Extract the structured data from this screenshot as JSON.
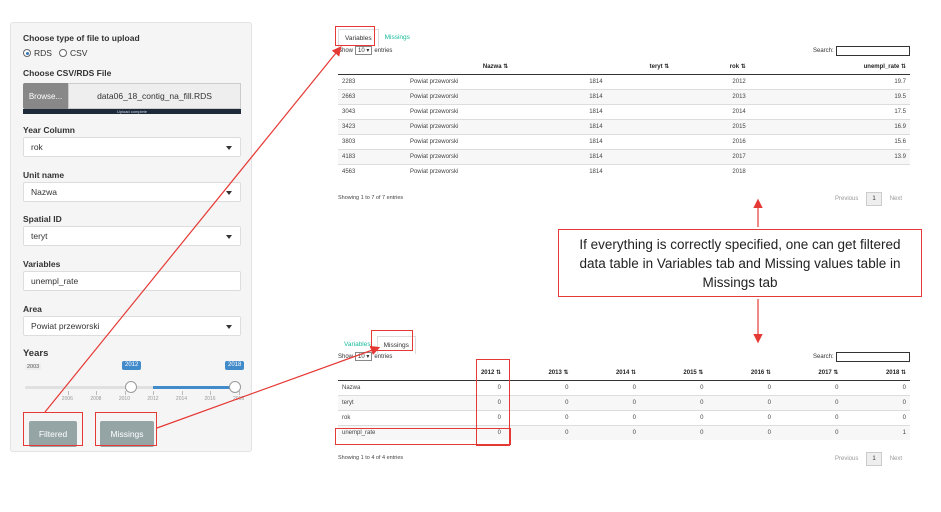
{
  "sidebar": {
    "file_type_label": "Choose type of file to upload",
    "radio_rds": "RDS",
    "radio_csv": "CSV",
    "file_label": "Choose CSV/RDS File",
    "browse_label": "Browse...",
    "file_name": "data06_18_contig_na_fill.RDS",
    "upload_status": "Upload complete",
    "year_col_label": "Year Column",
    "year_col_value": "rok",
    "unit_label": "Unit name",
    "unit_value": "Nazwa",
    "spatial_label": "Spatial ID",
    "spatial_value": "teryt",
    "variables_label": "Variables",
    "variables_value": "unempl_rate",
    "area_label": "Area",
    "area_value": "Powiat przeworski",
    "years_label": "Years",
    "years_min": "2003",
    "years_from": "2012",
    "years_to": "2018",
    "year_ticks": [
      "2006",
      "2008",
      "2010",
      "2012",
      "2014",
      "2016",
      "2018"
    ],
    "filtered_label": "Filtered",
    "missings_label": "Missings"
  },
  "top": {
    "tab_variables": "Variables",
    "tab_missings": "Missings",
    "show_label": "Show",
    "show_value": "10",
    "entries_label": "entries",
    "search_label": "Search:",
    "columns": [
      "",
      "Nazwa",
      "teryt",
      "rok",
      "unempl_rate"
    ],
    "rows": [
      [
        "2283",
        "Powiat przeworski",
        "1814",
        "2012",
        "19.7"
      ],
      [
        "2663",
        "Powiat przeworski",
        "1814",
        "2013",
        "19.5"
      ],
      [
        "3043",
        "Powiat przeworski",
        "1814",
        "2014",
        "17.5"
      ],
      [
        "3423",
        "Powiat przeworski",
        "1814",
        "2015",
        "16.9"
      ],
      [
        "3803",
        "Powiat przeworski",
        "1814",
        "2016",
        "15.6"
      ],
      [
        "4183",
        "Powiat przeworski",
        "1814",
        "2017",
        "13.9"
      ],
      [
        "4563",
        "Powiat przeworski",
        "1814",
        "2018",
        ""
      ]
    ],
    "info": "Showing 1 to 7 of 7 entries",
    "prev": "Previous",
    "page": "1",
    "next": "Next"
  },
  "bottom": {
    "tab_variables": "Variables",
    "tab_missings": "Missings",
    "show_label": "Show",
    "show_value": "10",
    "entries_label": "entries",
    "search_label": "Search:",
    "columns": [
      "",
      "2012",
      "2013",
      "2014",
      "2015",
      "2016",
      "2017",
      "2018"
    ],
    "rows": [
      [
        "Nazwa",
        "0",
        "0",
        "0",
        "0",
        "0",
        "0",
        "0"
      ],
      [
        "teryt",
        "0",
        "0",
        "0",
        "0",
        "0",
        "0",
        "0"
      ],
      [
        "rok",
        "0",
        "0",
        "0",
        "0",
        "0",
        "0",
        "0"
      ],
      [
        "unempl_rate",
        "0",
        "0",
        "0",
        "0",
        "0",
        "0",
        "1"
      ]
    ],
    "info": "Showing 1 to 4 of 4 entries",
    "prev": "Previous",
    "page": "1",
    "next": "Next"
  },
  "callout": "If everything is correctly specified, one can get filtered data table in Variables tab and Missing values table in Missings tab",
  "colors": {
    "annotation_red": "#e53935",
    "accent_blue": "#428bca",
    "tab_green": "#18bc9c",
    "button_gray": "#95a5a6"
  },
  "slider": {
    "min": 2003,
    "max": 2018,
    "from": 2012,
    "to": 2018
  }
}
